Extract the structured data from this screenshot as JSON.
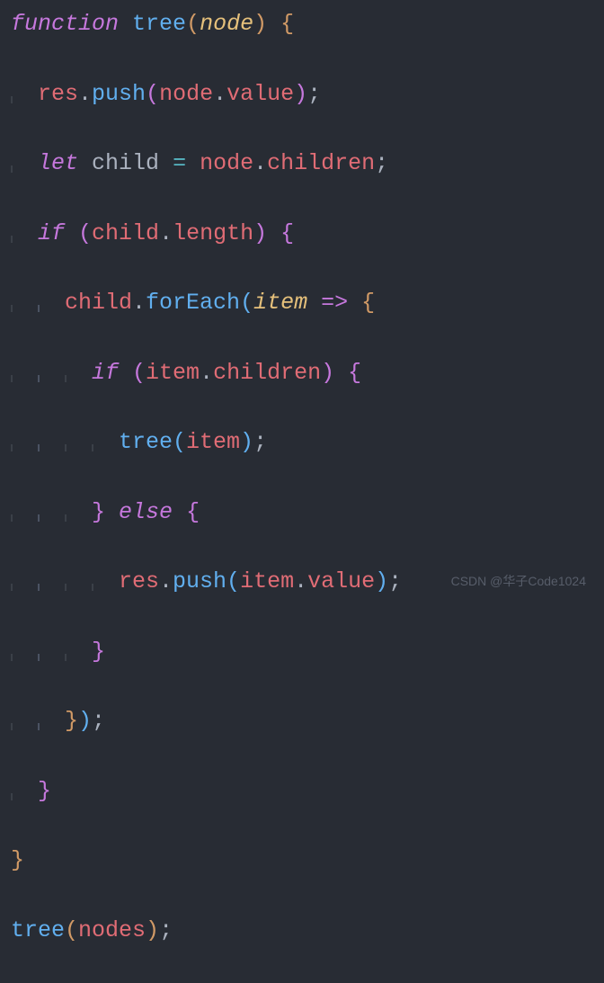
{
  "code": {
    "line1": {
      "kw": "function",
      "fn": "tree",
      "param": "node"
    },
    "line2": {
      "obj": "res",
      "method": "push",
      "arg1": "node",
      "prop": "value"
    },
    "line3": {
      "kw": "let",
      "varname": "child",
      "obj": "node",
      "prop": "children"
    },
    "line4": {
      "kw": "if",
      "obj": "child",
      "prop": "length"
    },
    "line5": {
      "obj": "child",
      "method": "forEach",
      "param": "item",
      "arrow": "=>"
    },
    "line6": {
      "kw": "if",
      "obj": "item",
      "prop": "children"
    },
    "line7": {
      "fn": "tree",
      "arg": "item"
    },
    "line8": {
      "kw": "else"
    },
    "line9": {
      "obj": "res",
      "method": "push",
      "arg1": "item",
      "prop": "value"
    },
    "line15": {
      "fn": "tree",
      "arg": "nodes"
    }
  },
  "watermark": "CSDN @华子Code1024"
}
